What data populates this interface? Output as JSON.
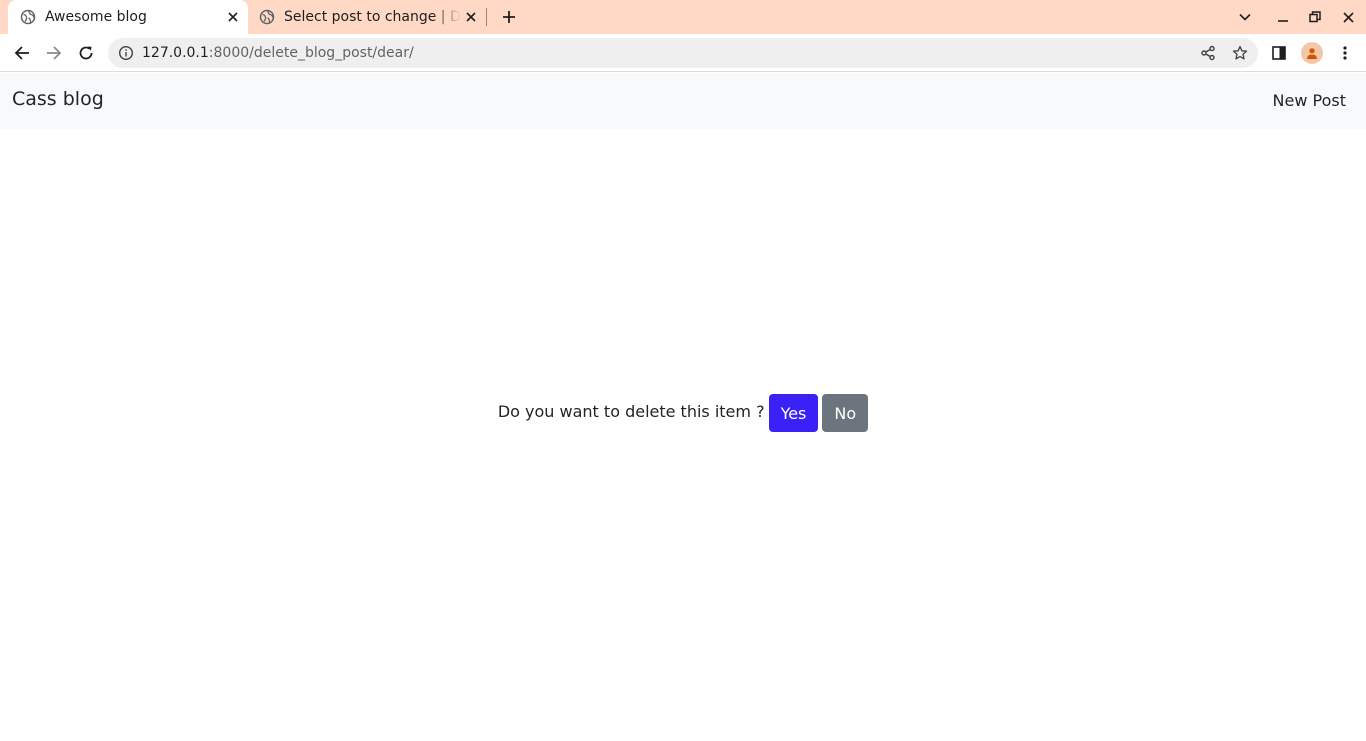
{
  "browser": {
    "tabs": [
      {
        "title": "Awesome blog",
        "active": true
      },
      {
        "title": "Select post to change | Django site admin",
        "active": false
      }
    ],
    "url_host": "127.0.0.1",
    "url_rest": ":8000/delete_blog_post/dear/",
    "icons": [
      "globe-icon",
      "close-icon",
      "plus-icon",
      "chevron-down-icon",
      "minimize-icon",
      "restore-icon",
      "back-icon",
      "forward-icon",
      "reload-icon",
      "info-icon",
      "share-icon",
      "star-icon",
      "side-panel-icon",
      "profile-icon",
      "kebab-menu-icon"
    ]
  },
  "app": {
    "brand": "Cass blog",
    "nav_link": "New Post"
  },
  "confirm": {
    "question": "Do you want to delete this item ?",
    "yes_label": "Yes",
    "no_label": "No"
  },
  "colors": {
    "tabstrip": "#ffd9c6",
    "yes_button": "#3a22f6",
    "no_button": "#6c757d",
    "navbar": "#f8f9fa"
  }
}
